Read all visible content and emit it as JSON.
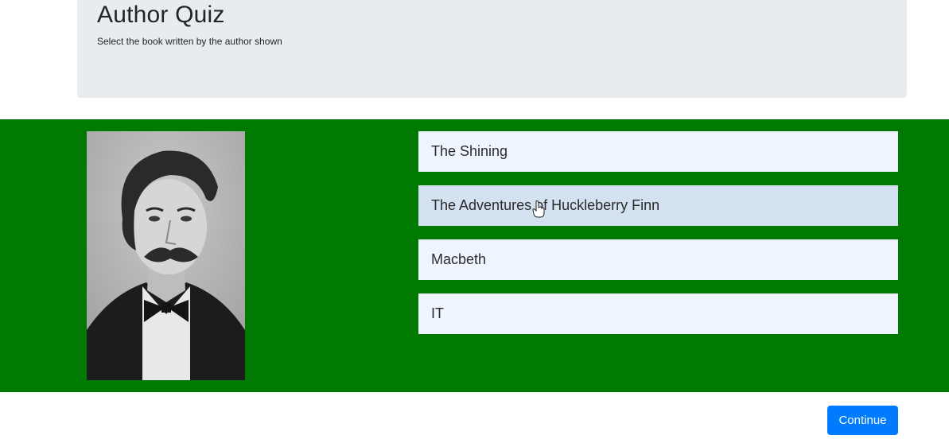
{
  "header": {
    "title": "Author Quiz",
    "subtitle": "Select the book written by the author shown"
  },
  "author": {
    "image_icon": "author-portrait"
  },
  "answers": [
    {
      "label": "The Shining",
      "hovered": false
    },
    {
      "label": "The Adventures of Huckleberry Finn",
      "hovered": true
    },
    {
      "label": "Macbeth",
      "hovered": false
    },
    {
      "label": "IT",
      "hovered": false
    }
  ],
  "footer": {
    "continue_label": "Continue"
  },
  "colors": {
    "band": "#007a00",
    "jumbotron": "#e9ecef",
    "answer_bg": "#eef5ff",
    "answer_hover": "#d3e1f1",
    "primary": "#007bff"
  }
}
